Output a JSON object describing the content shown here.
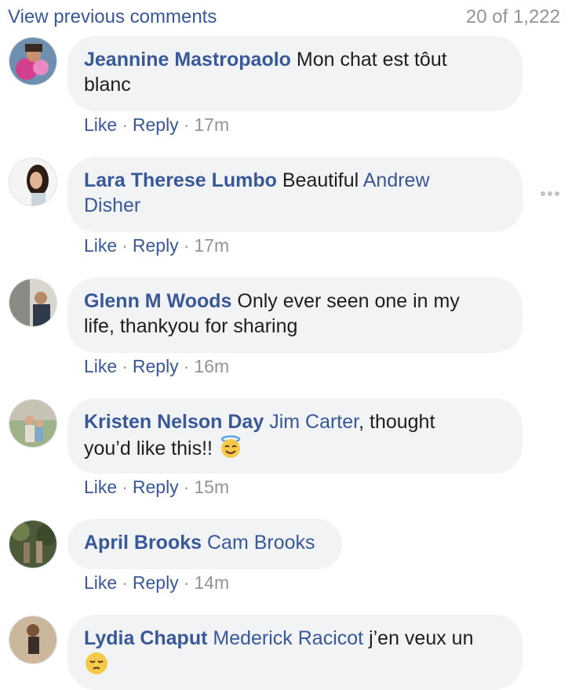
{
  "header": {
    "view_previous": "View previous comments",
    "count": "20 of 1,222"
  },
  "action_labels": {
    "like": "Like",
    "reply": "Reply",
    "separator": "·"
  },
  "comments": [
    {
      "author": "Jeannine Mastropaolo",
      "text_lines": [
        "Mon chat est tôut",
        "blanc"
      ],
      "time": "17m"
    },
    {
      "author": "Lara Therese Lumbo",
      "text": "Beautiful",
      "mention_lines": [
        "Andrew",
        "Disher"
      ],
      "time": "17m"
    },
    {
      "author": "Glenn M Woods",
      "text_lines": [
        "Only ever seen one in my",
        "life, thankyou for sharing"
      ],
      "time": "16m"
    },
    {
      "author": "Kristen Nelson Day",
      "mention": "Jim Carter",
      "text_lines": [
        ", thought",
        "you’d like this!!"
      ],
      "emoji": "smiling-face-with-halo-emoji",
      "time": "15m"
    },
    {
      "author": "April Brooks",
      "mention": "Cam Brooks",
      "time": "14m"
    },
    {
      "author": "Lydia Chaput",
      "mention": "Mederick Racicot",
      "text": "j’en veux un",
      "emoji": "pensive-face-emoji"
    }
  ],
  "icons": {
    "more": "more-options-icon"
  }
}
